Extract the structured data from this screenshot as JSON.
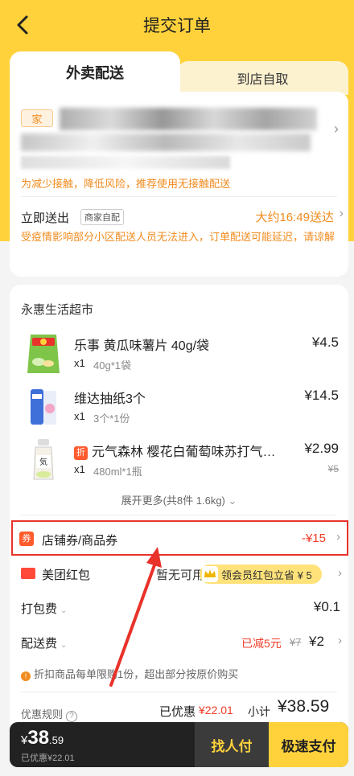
{
  "header": {
    "title": "提交订单"
  },
  "tabs": [
    {
      "label": "外卖配送",
      "active": true
    },
    {
      "label": "到店自取",
      "active": false
    }
  ],
  "address": {
    "tag": "家"
  },
  "notice_contactless": "为减少接触，降低风险，推荐使用无接触配送",
  "delivery": {
    "send_now": "立即送出",
    "merchant_badge": "商家自配",
    "eta": "大约16:49送达",
    "notice": "受疫情影响部分小区配送人员无法进入，订单配送可能延迟，请谅解"
  },
  "store": {
    "name": "永惠生活超市"
  },
  "items": [
    {
      "name": "乐事 黄瓜味薯片 40g/袋",
      "qty": "x1",
      "spec": "40g*1袋",
      "price": "¥4.5",
      "orig_price": ""
    },
    {
      "name": "维达抽纸3个",
      "qty": "x1",
      "spec": "3个*1份",
      "price": "¥14.5",
      "orig_price": ""
    },
    {
      "name": "元气森林 樱花白葡萄味苏打气…",
      "tag": "折",
      "qty": "x1",
      "spec": "480ml*1瓶",
      "price": "¥2.99",
      "orig_price": "¥5"
    }
  ],
  "expand_more": "展开更多(共8件 1.6kg)",
  "coupon": {
    "icon": "券",
    "label": "店铺券/商品券",
    "value": "-¥15"
  },
  "redpacket": {
    "label": "美团红包",
    "value": "暂无可用",
    "vip_text": "领会员红包立省 ¥ 5"
  },
  "packing_fee": {
    "label": "打包费",
    "value": "¥0.1"
  },
  "delivery_fee": {
    "label": "配送费",
    "discount": "已减5元",
    "orig": "¥7",
    "value": "¥2"
  },
  "limit_note": "折扣商品每单限购1份，超出部分按原价购买",
  "summary": {
    "rule_label": "优惠规则",
    "saved_label": "已优惠",
    "saved_value": "¥22.01",
    "subtotal_label": "小计",
    "subtotal_value": "¥38.59"
  },
  "bottom": {
    "currency": "¥",
    "total_int": "38",
    "total_dec": ".59",
    "saved_text": "已优惠¥22.01",
    "friend_pay": "找人付",
    "pay": "极速支付"
  },
  "colors": {
    "brand": "#ffd23c",
    "accent": "#f08c20",
    "red": "#f03c28",
    "highlight_box": "#e8322a"
  }
}
